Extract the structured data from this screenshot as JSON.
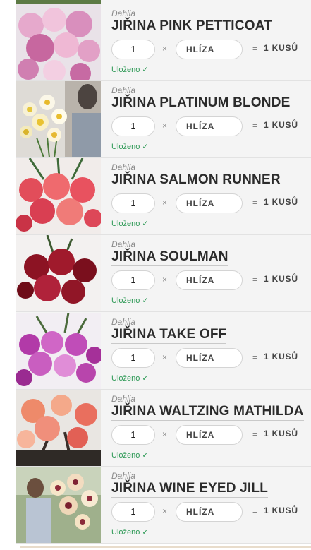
{
  "rows": [
    {
      "genus": "Dahlia",
      "name": "JIŘINA PINK PETTICOAT",
      "qty": "1",
      "times": "×",
      "unit": "HLÍZA",
      "equals": "=",
      "total": "1 KUSŮ",
      "saved": "Uloženo",
      "check": "✓",
      "photo": "pink-dahlias"
    },
    {
      "genus": "Dahlia",
      "name": "JIŘINA PLATINUM BLONDE",
      "qty": "1",
      "times": "×",
      "unit": "HLÍZA",
      "equals": "=",
      "total": "1 KUSŮ",
      "saved": "Uloženo",
      "check": "✓",
      "photo": "white-yellow-dahlias"
    },
    {
      "genus": "Dahlia",
      "name": "JIŘINA SALMON RUNNER",
      "qty": "1",
      "times": "×",
      "unit": "HLÍZA",
      "equals": "=",
      "total": "1 KUSŮ",
      "saved": "Uloženo",
      "check": "✓",
      "photo": "salmon-dahlias"
    },
    {
      "genus": "Dahlia",
      "name": "JIŘINA SOULMAN",
      "qty": "1",
      "times": "×",
      "unit": "HLÍZA",
      "equals": "=",
      "total": "1 KUSŮ",
      "saved": "Uloženo",
      "check": "✓",
      "photo": "dark-red-dahlias"
    },
    {
      "genus": "Dahlia",
      "name": "JIŘINA TAKE OFF",
      "qty": "1",
      "times": "×",
      "unit": "HLÍZA",
      "equals": "=",
      "total": "1 KUSŮ",
      "saved": "Uloženo",
      "check": "✓",
      "photo": "purple-dahlias"
    },
    {
      "genus": "Dahlia",
      "name": "JIŘINA WALTZING MATHILDA",
      "qty": "1",
      "times": "×",
      "unit": "HLÍZA",
      "equals": "=",
      "total": "1 KUSŮ",
      "saved": "Uloženo",
      "check": "✓",
      "photo": "orange-pink-dahlias"
    },
    {
      "genus": "Dahlia",
      "name": "JIŘINA WINE EYED JILL",
      "qty": "1",
      "times": "×",
      "unit": "HLÍZA",
      "equals": "=",
      "total": "1 KUSŮ",
      "saved": "Uloženo",
      "check": "✓",
      "photo": "cream-dahlias"
    }
  ],
  "colors": {
    "saved_green": "#2f9a57",
    "row_background": "#f4f4f4"
  }
}
